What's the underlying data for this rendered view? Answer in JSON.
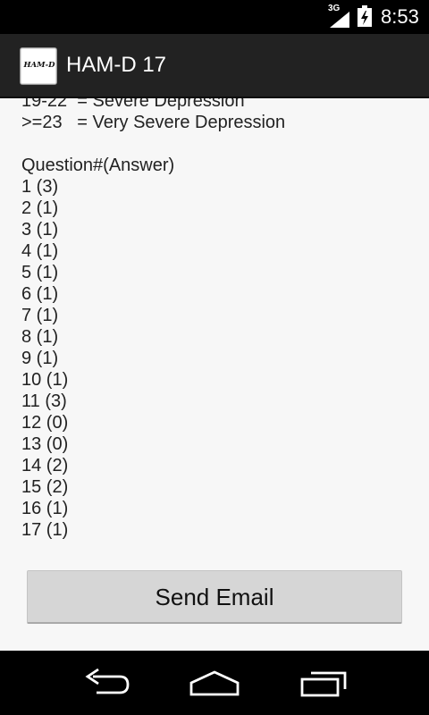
{
  "status_bar": {
    "network": "3G",
    "clock": "8:53"
  },
  "app_bar": {
    "logo_text": "HAM-D",
    "title": "HAM-D 17"
  },
  "content": {
    "lines": [
      "19-22  = Severe Depression",
      ">=23   = Very Severe Depression",
      "",
      "Question#(Answer)",
      "1 (3)",
      "2 (1)",
      "3 (1)",
      "4 (1)",
      "5 (1)",
      "6 (1)",
      "7 (1)",
      "8 (1)",
      "9 (1)",
      "10 (1)",
      "11 (3)",
      "12 (0)",
      "13 (0)",
      "14 (2)",
      "15 (2)",
      "16 (1)",
      "17 (1)"
    ],
    "send_button_label": "Send Email"
  },
  "nav_bar": {
    "back_icon": "back-icon",
    "home_icon": "home-icon",
    "recents_icon": "recent-apps-icon"
  }
}
